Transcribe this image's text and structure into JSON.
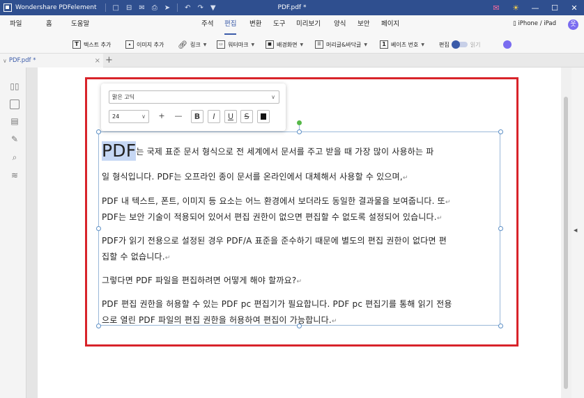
{
  "titlebar": {
    "app_name": "Wondershare PDFelement",
    "doc_title": "PDF.pdf *",
    "quick_icons": [
      "□",
      "⊟",
      "✉",
      "⎙",
      "➤",
      "↶",
      "↷",
      "▼"
    ],
    "right_icons": [
      "✉",
      "☀",
      "—",
      "☐",
      "✕"
    ]
  },
  "menubar": {
    "left_items": [
      "파일",
      "홈",
      "도움말"
    ],
    "center_items": [
      "주석",
      "편집",
      "변환",
      "도구",
      "미리보기",
      "양식",
      "보안",
      "페이지"
    ],
    "active_item": "편집",
    "device_label": "iPhone / iPad",
    "avatar_glyph": "웃"
  },
  "toolbar": {
    "add_text": "텍스트 추가",
    "add_image": "이미지 추가",
    "link": "링크",
    "watermark": "워터마크",
    "background": "배경화면",
    "header_footer": "머리글&바닥글",
    "bates": "베이츠 번호",
    "edit": "편집",
    "read": "읽기"
  },
  "tab": {
    "name": "PDF.pdf *",
    "close": "×",
    "add": "+"
  },
  "font_popup": {
    "font_name": "맑은 고딕",
    "font_size": "24",
    "buttons": [
      "+",
      "—",
      "B",
      "I",
      "U",
      "S"
    ]
  },
  "document": {
    "big_word": "PDF",
    "lines": [
      "는 국제 표준 문서 형식으로 전 세계에서 문서를 주고 받을 때 가장 많이 사용하는 파",
      "일 형식입니다. PDF는 오프라인 종이 문서를 온라인에서 대체해서 사용할 수 있으며,",
      "PDF 내 텍스트, 폰트, 이미지 등 요소는 어느 환경에서 보더라도 동일한 결과물을 보여줍니다. 또",
      "PDF는 보안 기술이 적용되어 있어서 편집 권한이 없으면 편집할 수 없도록 설정되어 있습니다.",
      "PDF가 읽기 전용으로 설정된 경우 PDF/A 표준을 준수하기 때문에 별도의 편집 권한이 없다면 편",
      "집할 수 없습니다.",
      "그렇다면 PDF 파일을 편집하려면 어떻게 해야 할까요?",
      "PDF 편집 권한을 허용할 수 있는 PDF pc 편집기가 필요합니다. PDF pc 편집기를 통해 읽기 전용",
      "으로 열린 PDF 파일의 편집 권한을 허용하여 편집이 가능합니다."
    ],
    "para_mark": "↵"
  },
  "colors": {
    "titlebar": "#2f4f8f",
    "accent": "#3b5ba9",
    "highlight_border": "#d8232a",
    "selection": "#c6d7f4"
  }
}
